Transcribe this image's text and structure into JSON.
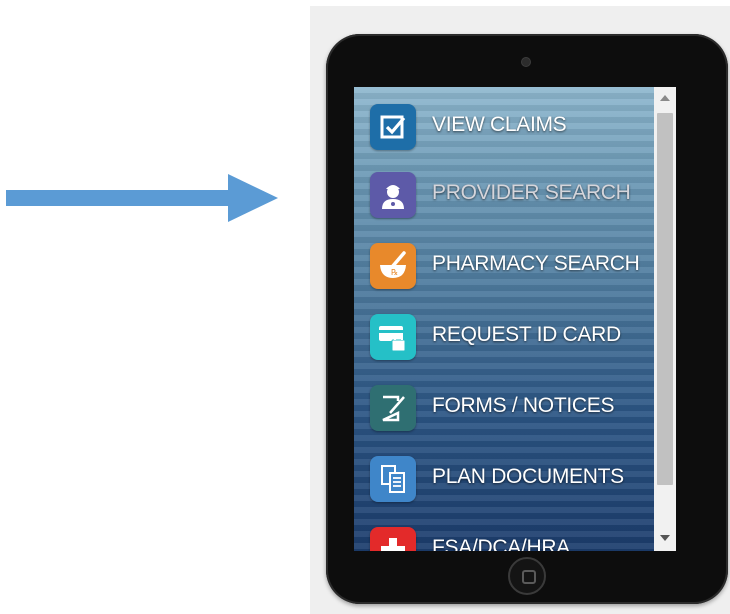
{
  "pointer": {
    "icon": "right-arrow-icon",
    "color": "#5b9bd5"
  },
  "menu": {
    "items": [
      {
        "label": "VIEW CLAIMS",
        "icon": "checkbox-icon",
        "color": "#1e6ea8"
      },
      {
        "label": "PROVIDER SEARCH",
        "icon": "doctor-icon",
        "color": "#5d5aa8"
      },
      {
        "label": "PHARMACY SEARCH",
        "icon": "mortar-pestle-icon",
        "color": "#e8892b"
      },
      {
        "label": "REQUEST ID CARD",
        "icon": "id-card-lock-icon",
        "color": "#25c0c7"
      },
      {
        "label": "FORMS / NOTICES",
        "icon": "edit-form-icon",
        "color": "#2f6f72"
      },
      {
        "label": "PLAN DOCUMENTS",
        "icon": "documents-icon",
        "color": "#3f86c9"
      },
      {
        "label": "FSA/DCA/HRA",
        "icon": "medical-cross-icon",
        "color": "#e32a2a"
      }
    ]
  },
  "scrollbar": {
    "position": 0
  }
}
